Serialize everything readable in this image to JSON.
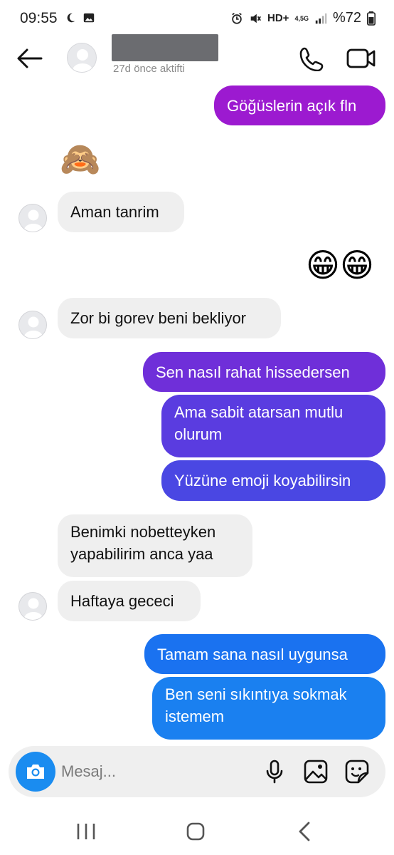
{
  "status_bar": {
    "time": "09:55",
    "network": "HD+",
    "network_gen": "4,5G",
    "battery": "%72"
  },
  "header": {
    "last_active": "27d önce aktifti"
  },
  "messages": [
    {
      "dir": "out",
      "text": "Göğüslerin açık fln",
      "color": "#9c1ad0"
    },
    {
      "dir": "in",
      "emoji": "🙈"
    },
    {
      "dir": "in",
      "text": "Aman tanrim"
    },
    {
      "dir": "out",
      "emoji": "😁😁"
    },
    {
      "dir": "in",
      "text": "Zor bi gorev beni bekliyor"
    },
    {
      "dir": "out",
      "text": "Sen nasıl rahat hissedersen",
      "color": "#6f2fd9"
    },
    {
      "dir": "out",
      "text": "Ama sabit atarsan mutlu olurum",
      "color": "#5a3ce0"
    },
    {
      "dir": "out",
      "text": "Yüzüne emoji koyabilirsin",
      "color": "#4a47e3"
    },
    {
      "dir": "in",
      "text": "Benimki nobetteyken yapabilirim anca yaa"
    },
    {
      "dir": "in",
      "text": "Haftaya gececi"
    },
    {
      "dir": "out",
      "text": "Tamam sana nasıl uygunsa",
      "color": "#1a72f0"
    },
    {
      "dir": "out",
      "text": "Ben seni sıkıntıya sokmak istemem",
      "color": "#1a80f0"
    }
  ],
  "composer": {
    "placeholder": "Mesaj..."
  },
  "colors": {
    "incoming_bubble": "#efefef",
    "camera_button": "#1a8cf0"
  },
  "icons": [
    "back-arrow-icon",
    "phone-icon",
    "video-camera-icon",
    "camera-icon",
    "microphone-icon",
    "gallery-icon",
    "sticker-icon",
    "recents-icon",
    "home-icon",
    "back-nav-icon"
  ]
}
